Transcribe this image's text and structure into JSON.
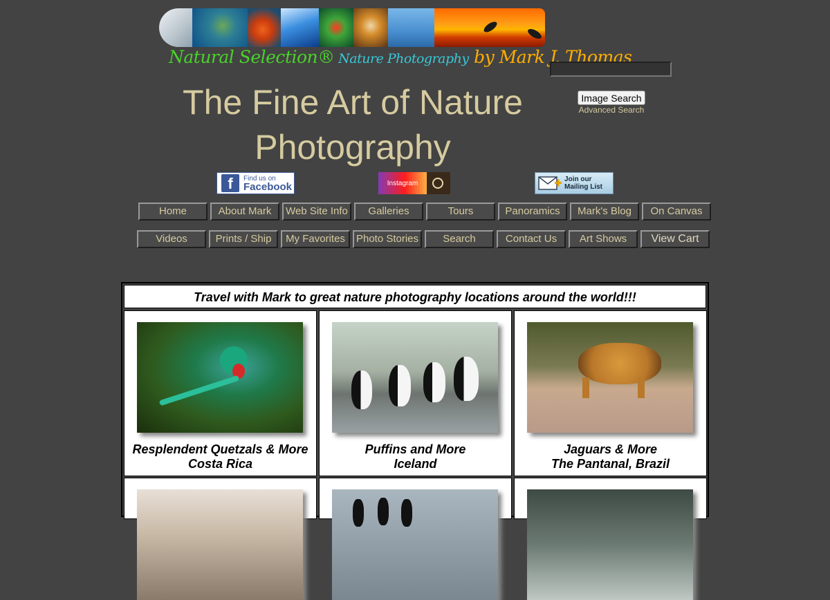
{
  "header": {
    "brand": {
      "part1": "Natural Selection®",
      "part2": " Nature Photography",
      "part3": " by Mark J. Thomas"
    },
    "title": "The Fine Art of Nature Photography"
  },
  "search": {
    "value": "",
    "button_label": "Image Search",
    "advanced_link": "Advanced Search"
  },
  "social": {
    "facebook": {
      "line1": "Find us on",
      "line2": "Facebook"
    },
    "instagram": {
      "label": "Instagram"
    },
    "mailing": {
      "line1": "Join our",
      "line2": "Mailing List"
    }
  },
  "nav": {
    "row1": [
      "Home",
      "About Mark",
      "Web Site Info",
      "Galleries",
      "Tours",
      "Panoramics",
      "Mark's Blog",
      "On Canvas"
    ],
    "row2": [
      "Videos",
      "Prints / Ship",
      "My Favorites",
      "Photo Stories",
      "Search",
      "Contact Us",
      "Art Shows",
      "View Cart"
    ]
  },
  "tours": {
    "heading": "Travel with Mark to great nature photography locations around the world!!!",
    "items": [
      {
        "title": "Resplendent Quetzals & More",
        "location": "Costa Rica",
        "image": "quetzal-photo"
      },
      {
        "title": "Puffins and More",
        "location": "Iceland",
        "image": "puffins-photo"
      },
      {
        "title": "Jaguars & More",
        "location": "The Pantanal, Brazil",
        "image": "jaguar-photo"
      },
      {
        "title": "",
        "location": "",
        "image": "birds-photo"
      },
      {
        "title": "",
        "location": "",
        "image": "king-penguins-photo"
      },
      {
        "title": "",
        "location": "",
        "image": "feather-photo"
      }
    ]
  },
  "colors": {
    "background": "#434343",
    "accent_text": "#d6cba0",
    "nav_button": "#4a4a4a"
  }
}
